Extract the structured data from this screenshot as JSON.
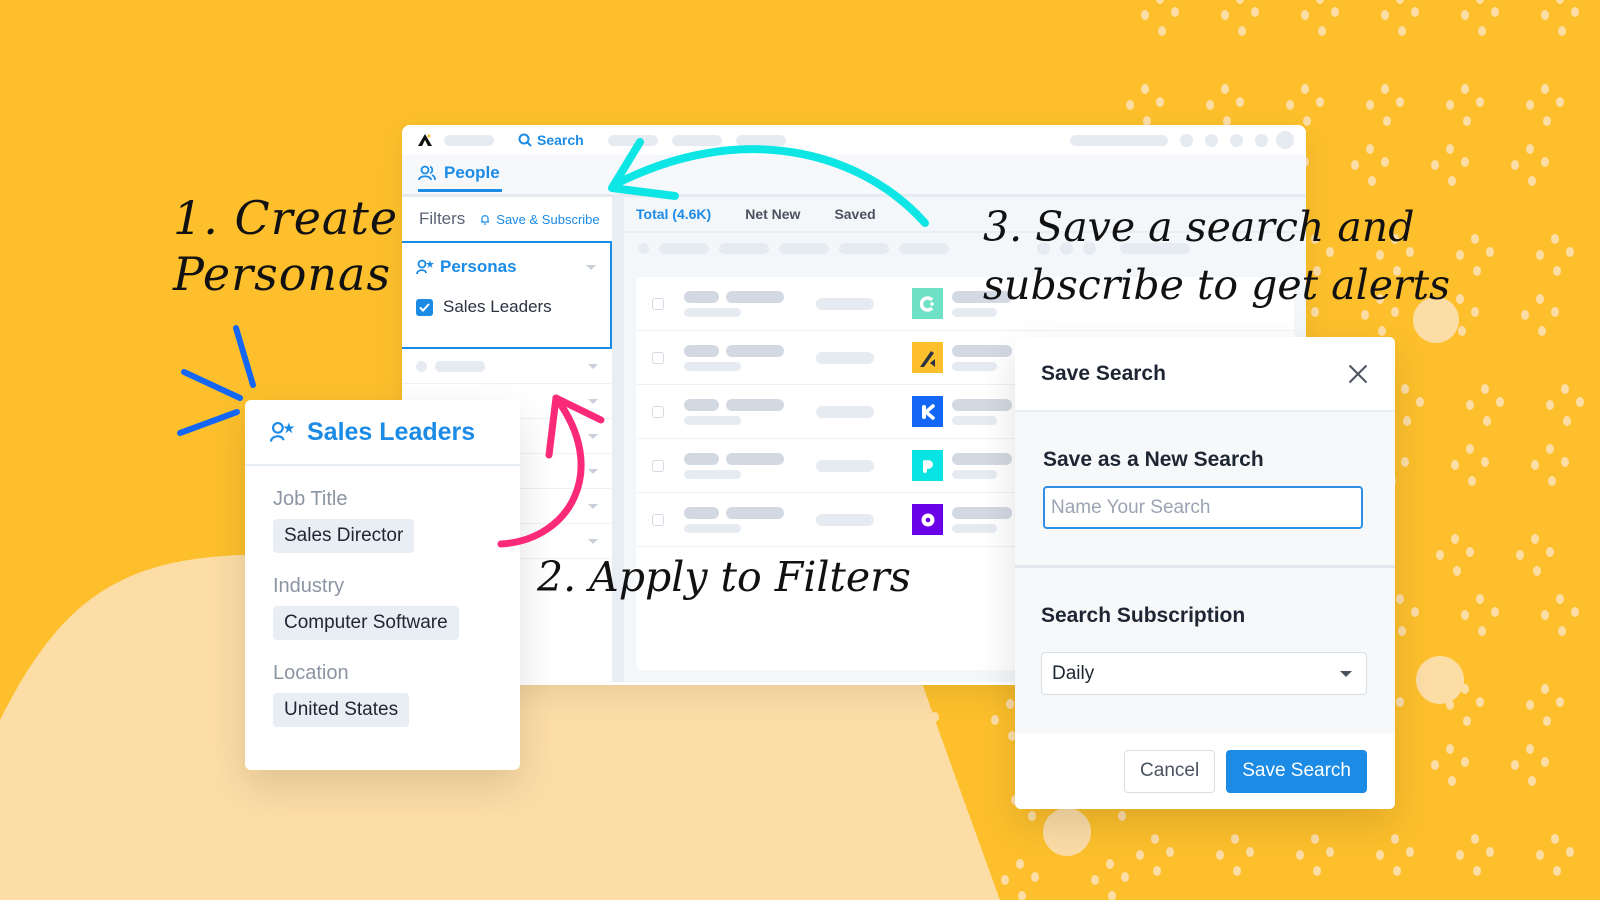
{
  "annotations": {
    "step1": [
      "1. Create",
      "Personas"
    ],
    "step2": "2. Apply to Filters",
    "step3": [
      "3. Save a search and",
      "subscribe to get alerts"
    ]
  },
  "app": {
    "logo_icon": "apollo-logo-icon",
    "nav_search_label": "Search",
    "tab_people": "People",
    "filters_label": "Filters",
    "save_subscribe_label": "Save & Subscribe",
    "personas_label": "Personas",
    "persona_checked": {
      "label": "Sales Leaders",
      "checked": true
    },
    "result_tabs": [
      {
        "label": "Total (4.6K)",
        "active": true
      },
      {
        "label": "Net New",
        "active": false
      },
      {
        "label": "Saved",
        "active": false
      }
    ],
    "company_logos": [
      {
        "name": "company-logo-teal",
        "color": "#6ee0c5"
      },
      {
        "name": "company-logo-yellow",
        "color": "#fdc02c"
      },
      {
        "name": "company-logo-blue",
        "color": "#1466f5"
      },
      {
        "name": "company-logo-cyan",
        "color": "#08e3e3"
      },
      {
        "name": "company-logo-purple",
        "color": "#6a00e8"
      }
    ]
  },
  "persona_card": {
    "title": "Sales Leaders",
    "fields": [
      {
        "label": "Job Title",
        "value": "Sales Director"
      },
      {
        "label": "Industry",
        "value": "Computer Software"
      },
      {
        "label": "Location",
        "value": "United States"
      }
    ]
  },
  "modal": {
    "title": "Save Search",
    "new_search_heading": "Save as a New Search",
    "name_placeholder": "Name Your Search",
    "name_value": "",
    "subscription_heading": "Search Subscription",
    "subscription_value": "Daily",
    "cancel_label": "Cancel",
    "save_label": "Save Search"
  },
  "colors": {
    "background": "#fdc02c",
    "accent": "#1b8be6",
    "arrow_cyan": "#0ee6e6",
    "arrow_pink": "#fb2a78",
    "spark_blue": "#1466f5"
  }
}
